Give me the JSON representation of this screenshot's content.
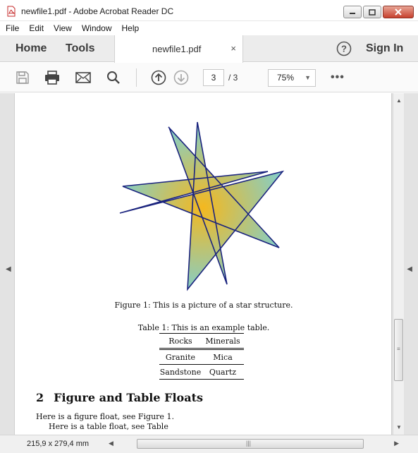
{
  "window": {
    "title": "newfile1.pdf - Adobe Acrobat Reader DC"
  },
  "menu": [
    "File",
    "Edit",
    "View",
    "Window",
    "Help"
  ],
  "tabs": {
    "home": "Home",
    "tools": "Tools",
    "document": "newfile1.pdf",
    "close_glyph": "×",
    "help_glyph": "?",
    "sign_in": "Sign In"
  },
  "toolbar": {
    "icons": [
      "save-icon",
      "print-icon",
      "email-icon",
      "search-icon",
      "page-up-icon",
      "page-down-icon"
    ],
    "current_page": "3",
    "total_pages": "/ 3",
    "zoom": "75%",
    "more": "•••"
  },
  "document": {
    "figure_caption": "Figure 1: This is a picture of a star structure.",
    "table_caption": "Table 1: This is an example table.",
    "table": {
      "headers": [
        "Rocks",
        "Minerals"
      ],
      "rows": [
        [
          "Granite",
          "Mica"
        ],
        [
          "Sandstone",
          "Quartz"
        ]
      ]
    },
    "section_number": "2",
    "section_title": "Figure and Table Floats",
    "body_line1": "Here is a figure float, see Figure 1.",
    "body_line2": "Here is a table float, see Table",
    "star_colors": {
      "center": "#f4b81f",
      "edge": "#7fcfd0",
      "stroke": "#1a237e"
    }
  },
  "statusbar": {
    "page_size": "215,9 x 279,4 mm",
    "grip": "|||"
  }
}
